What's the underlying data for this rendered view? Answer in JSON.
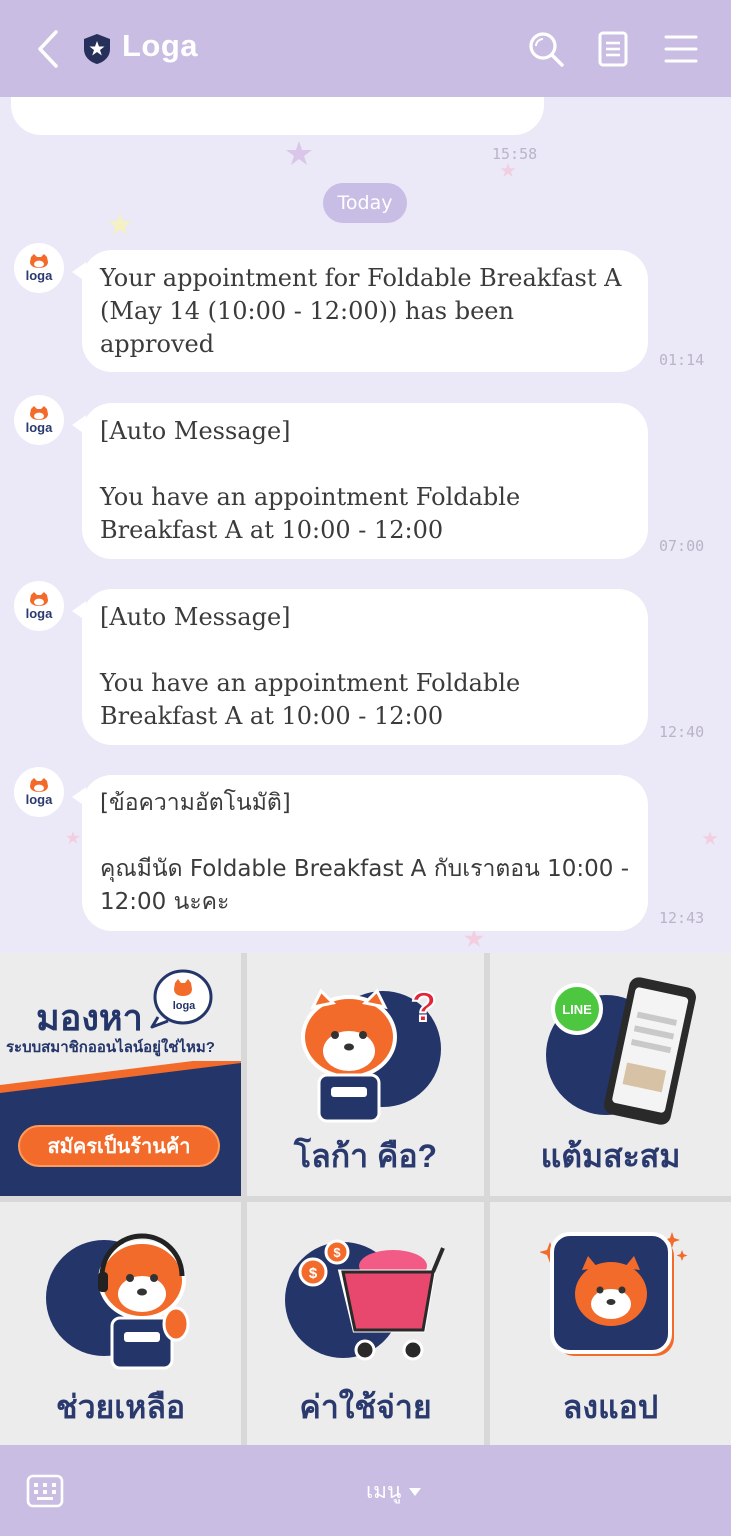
{
  "header": {
    "title": "Loga",
    "icons": [
      "back-arrow-icon",
      "shield-star-icon",
      "search-icon",
      "notes-icon",
      "menu-icon"
    ],
    "bg_color": "#c9bde3"
  },
  "chat": {
    "previous_time": "15:58",
    "date_divider": "Today",
    "avatar_label": "loga",
    "messages": [
      {
        "text": "Your appointment for Foldable Breakfast A (May 14 (10:00 - 12:00)) has been approved",
        "time": "01:14"
      },
      {
        "text": "[Auto Message]\n\nYou have an appointment Foldable Breakfast A at 10:00 - 12:00",
        "time": "07:00"
      },
      {
        "text": "[Auto Message]\n\nYou have an appointment Foldable Breakfast A at 10:00 - 12:00",
        "time": "12:40"
      },
      {
        "text": "[ข้อความอัตโนมัติ]\n\nคุณมีนัด Foldable Breakfast A กับเราตอน 10:00 - 12:00 นะคะ",
        "time": "12:43"
      }
    ]
  },
  "menu": {
    "promo": {
      "title": "มองหา",
      "badge": "loga",
      "subtitle": "ระบบสมาชิกออนไลน์อยู่ใช่ไหม?",
      "button": "สมัครเป็นร้านค้า"
    },
    "tiles": [
      {
        "label": "โลก้า คือ?",
        "icon": "tiger-question-icon"
      },
      {
        "label": "แต้มสะสม",
        "icon": "phone-line-icon"
      },
      {
        "label": "ช่วยเหลือ",
        "icon": "tiger-headset-icon"
      },
      {
        "label": "ค่าใช้จ่าย",
        "icon": "shopping-cart-icon"
      },
      {
        "label": "ลงแอป",
        "icon": "app-tiger-icon"
      }
    ],
    "label_color": "#2b3a6e",
    "accent_orange": "#f26b2a"
  },
  "bottombar": {
    "menu_label": "เมนู",
    "icons": [
      "keyboard-icon",
      "caret-down-icon"
    ]
  }
}
